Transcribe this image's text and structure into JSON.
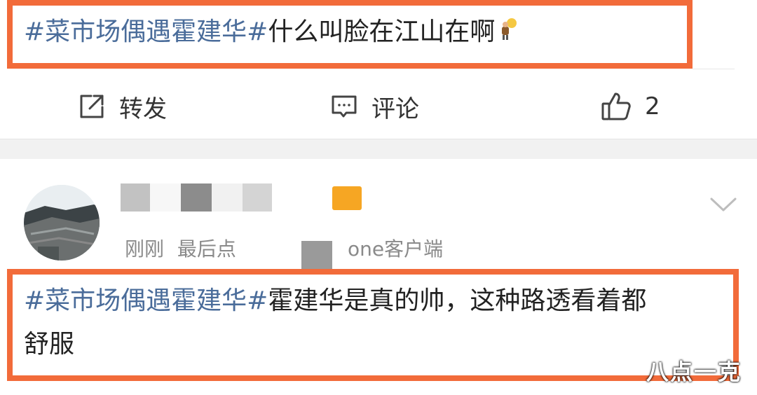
{
  "post1": {
    "topic": "#菜市场偶遇霍建华#",
    "text": "什么叫脸在江山在啊"
  },
  "actions": {
    "repost_label": "转发",
    "comment_label": "评论",
    "like_count": "2"
  },
  "comment": {
    "time_text": "刚刚",
    "source_prefix": "最后点",
    "source_suffix": "one客户端",
    "topic": "#菜市场偶遇霍建华#",
    "text_line1": "霍建华是真的帅，这种路透看着都",
    "text_line2": "舒服"
  },
  "watermark": "八点一克",
  "colors": {
    "highlight_border": "#f26b3a",
    "topic_link": "#4a6c9a"
  }
}
